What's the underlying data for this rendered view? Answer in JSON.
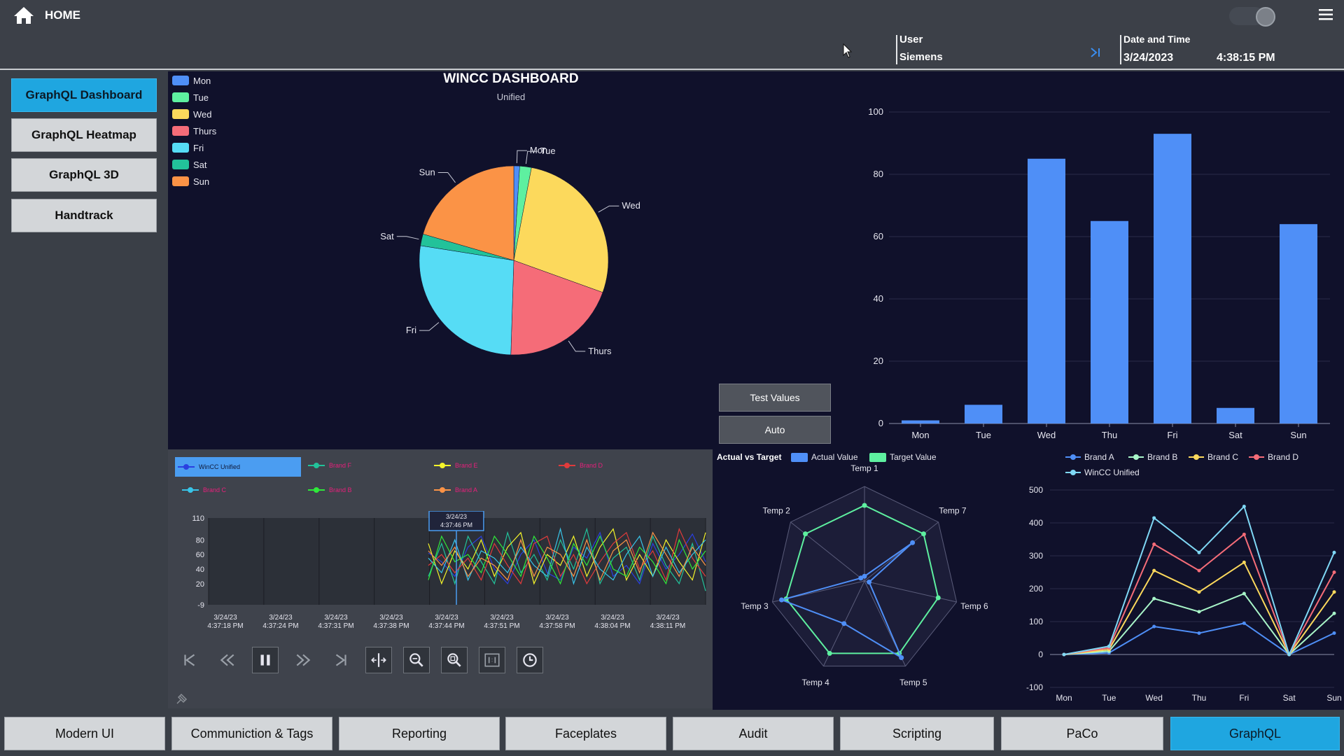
{
  "header": {
    "home_label": "HOME",
    "user_label": "User",
    "user_value": "Siemens",
    "datetime_label": "Date and Time",
    "date_value": "3/24/2023",
    "time_value": "4:38:15 PM"
  },
  "sidebar": {
    "items": [
      {
        "label": "GraphQL Dashboard",
        "active": true
      },
      {
        "label": "GraphQL Heatmap",
        "active": false
      },
      {
        "label": "GraphQL 3D",
        "active": false
      },
      {
        "label": "Handtrack",
        "active": false
      }
    ]
  },
  "dashboard": {
    "title": "WINCC DASHBOARD",
    "subtitle": "Unified",
    "test_values_label": "Test Values",
    "auto_label": "Auto",
    "small_icon": "pin-icon"
  },
  "colors": {
    "blue": "#4f8ff7",
    "green": "#5ef0a0",
    "yellow": "#fcd95c",
    "red": "#f56c78",
    "cyan": "#56dcf5",
    "teal": "#22c29a",
    "orange": "#fb9346",
    "active": "#1fa6e0"
  },
  "chart_data": [
    {
      "type": "pie",
      "legend": [
        "Mon",
        "Tue",
        "Wed",
        "Thurs",
        "Fri",
        "Sat",
        "Sun"
      ],
      "slice_labels": [
        "Mon",
        "Tue",
        "Wed",
        "Thurs",
        "Fri",
        "Sat",
        "Sun"
      ],
      "values": [
        1,
        2,
        27.5,
        20,
        27,
        2,
        20.5
      ],
      "colors": [
        "#4f8ff7",
        "#5ef0a0",
        "#fcd95c",
        "#f56c78",
        "#56dcf5",
        "#22c29a",
        "#fb9346"
      ],
      "legend_position": "top-left"
    },
    {
      "type": "bar",
      "categories": [
        "Mon",
        "Tue",
        "Wed",
        "Thu",
        "Fri",
        "Sat",
        "Sun"
      ],
      "values": [
        1,
        6,
        85,
        65,
        93,
        5,
        64
      ],
      "ylim": [
        0,
        100
      ],
      "yticks": [
        0,
        20,
        40,
        60,
        80,
        100
      ],
      "grid": true
    },
    {
      "type": "line",
      "legend": [
        "WinCC Unified",
        "Brand F",
        "Brand E",
        "Brand D",
        "Brand C",
        "Brand B",
        "Brand A"
      ],
      "legend_colors": [
        "#2a3fe0",
        "#22c29a",
        "#f4f42a",
        "#e03b3b",
        "#38c4e8",
        "#2fe83a",
        "#fb9346"
      ],
      "yticks": [
        110,
        80,
        60,
        40,
        20,
        -9
      ],
      "xticks": [
        [
          "3/24/23",
          "4:37:18 PM"
        ],
        [
          "3/24/23",
          "4:37:24 PM"
        ],
        [
          "3/24/23",
          "4:37:31 PM"
        ],
        [
          "3/24/23",
          "4:37:38 PM"
        ],
        [
          "3/24/23",
          "4:37:44 PM"
        ],
        [
          "3/24/23",
          "4:37:51 PM"
        ],
        [
          "3/24/23",
          "4:37:58 PM"
        ],
        [
          "3/24/23",
          "4:38:04 PM"
        ],
        [
          "3/24/23",
          "4:38:11 PM"
        ]
      ],
      "cursor_label": [
        "3/24/23",
        "4:37:46 PM"
      ],
      "series": [
        {
          "name": "WinCC Unified",
          "values": [
            62,
            50,
            30,
            70,
            85,
            40,
            20,
            60,
            80,
            35,
            25,
            70,
            55,
            90,
            30,
            45,
            20,
            75,
            40,
            60,
            88,
            50
          ]
        },
        {
          "name": "Brand F",
          "values": [
            30,
            75,
            20,
            85,
            50,
            20,
            90,
            35,
            60,
            25,
            80,
            40,
            95,
            20,
            55,
            70,
            25,
            85,
            45,
            20,
            75,
            10
          ]
        },
        {
          "name": "Brand E",
          "values": [
            75,
            20,
            65,
            40,
            80,
            30,
            70,
            90,
            20,
            60,
            45,
            85,
            30,
            70,
            95,
            25,
            60,
            30,
            80,
            50,
            25,
            90
          ]
        },
        {
          "name": "Brand D",
          "values": [
            45,
            60,
            35,
            55,
            25,
            75,
            45,
            20,
            75,
            85,
            30,
            60,
            20,
            50,
            75,
            90,
            40,
            65,
            25,
            95,
            55,
            30
          ]
        },
        {
          "name": "Brand C",
          "values": [
            55,
            35,
            80,
            25,
            65,
            55,
            35,
            70,
            45,
            30,
            95,
            20,
            70,
            40,
            25,
            60,
            85,
            30,
            70,
            35,
            60,
            80
          ]
        },
        {
          "name": "Brand B",
          "values": [
            25,
            85,
            50,
            60,
            35,
            85,
            60,
            30,
            85,
            55,
            20,
            75,
            45,
            85,
            40,
            30,
            70,
            50,
            20,
            80,
            40,
            65
          ]
        },
        {
          "name": "Brand A",
          "values": [
            65,
            45,
            70,
            30,
            55,
            45,
            25,
            80,
            30,
            70,
            60,
            30,
            80,
            25,
            65,
            80,
            35,
            90,
            60,
            30,
            70,
            45
          ]
        }
      ]
    },
    {
      "type": "radar",
      "title": "Actual vs Target",
      "axes": [
        "Temp 1",
        "Temp 7",
        "Temp 6",
        "Temp 5",
        "Temp 4",
        "Temp 3",
        "Temp 2"
      ],
      "series": [
        {
          "name": "Actual Value",
          "values": [
            5,
            65,
            5,
            90,
            50,
            90,
            5
          ]
        },
        {
          "name": "Target Value",
          "values": [
            80,
            80,
            80,
            85,
            85,
            85,
            80
          ]
        }
      ],
      "max": 100
    },
    {
      "type": "line",
      "categories": [
        "Mon",
        "Tue",
        "Wed",
        "Thu",
        "Fri",
        "Sat",
        "Sun"
      ],
      "ylim": [
        -100,
        500
      ],
      "yticks": [
        500,
        400,
        300,
        200,
        100,
        0,
        -100
      ],
      "grid": true,
      "series": [
        {
          "name": "Brand A",
          "values": [
            0,
            5,
            85,
            65,
            95,
            0,
            65
          ]
        },
        {
          "name": "Brand B",
          "values": [
            0,
            10,
            170,
            130,
            185,
            0,
            125
          ]
        },
        {
          "name": "Brand C",
          "values": [
            0,
            15,
            255,
            190,
            280,
            0,
            190
          ]
        },
        {
          "name": "Brand D",
          "values": [
            0,
            20,
            335,
            255,
            365,
            0,
            250
          ]
        },
        {
          "name": "WinCC Unified",
          "values": [
            0,
            25,
            415,
            310,
            450,
            0,
            310
          ]
        }
      ],
      "colors": [
        "#4f8ff7",
        "#a8f5c8",
        "#fcd95c",
        "#f56c78",
        "#7fd8f5"
      ]
    }
  ],
  "bottom_nav": {
    "items": [
      {
        "label": "Modern UI",
        "active": false
      },
      {
        "label": "Communiction & Tags",
        "active": false
      },
      {
        "label": "Reporting",
        "active": false
      },
      {
        "label": "Faceplates",
        "active": false
      },
      {
        "label": "Audit",
        "active": false
      },
      {
        "label": "Scripting",
        "active": false
      },
      {
        "label": "PaCo",
        "active": false
      },
      {
        "label": "GraphQL",
        "active": true
      }
    ]
  },
  "trend_controls": {
    "buttons": [
      "first-icon",
      "rewind-icon",
      "pause-icon",
      "fast-forward-icon",
      "last-icon",
      "ruler-icon",
      "zoom-area-icon",
      "zoom-icon",
      "one-to-one-icon",
      "clock-icon"
    ]
  }
}
